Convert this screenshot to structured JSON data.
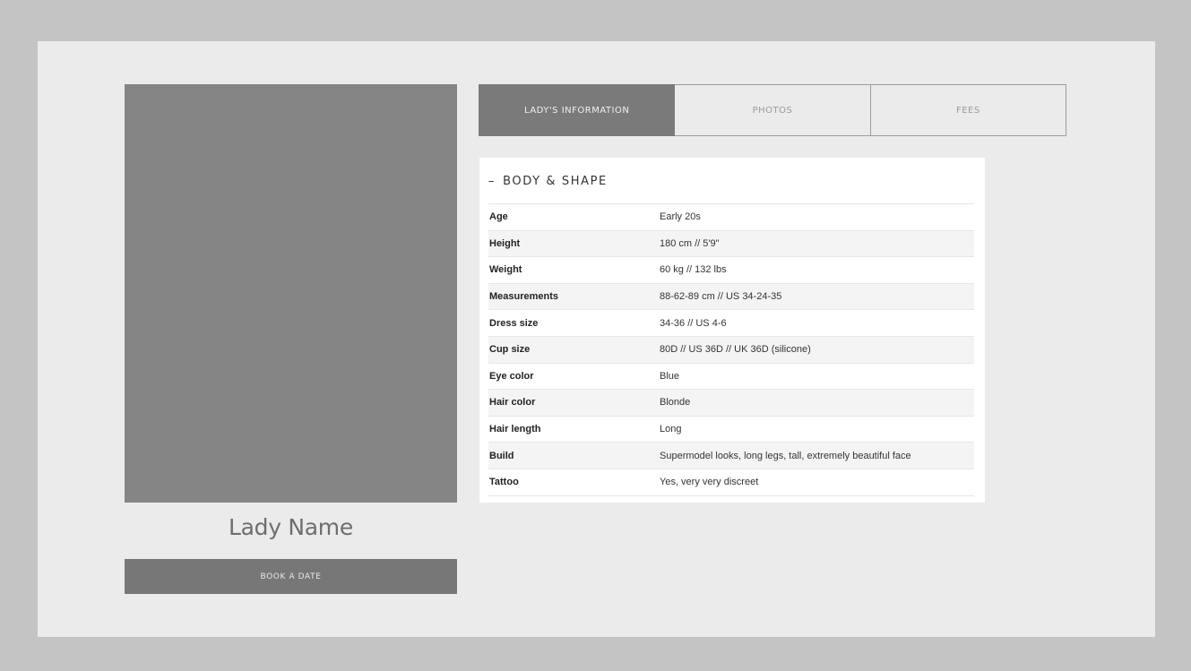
{
  "profile": {
    "name": "Lady Name",
    "book_label": "BOOK A DATE"
  },
  "tabs": [
    {
      "label": "LADY'S INFORMATION",
      "active": true
    },
    {
      "label": "PHOTOS",
      "active": false
    },
    {
      "label": "FEES",
      "active": false
    }
  ],
  "section": {
    "toggle": "–",
    "title": "BODY & SHAPE",
    "rows": [
      {
        "label": "Age",
        "value": "Early 20s"
      },
      {
        "label": "Height",
        "value": "180 cm // 5'9\""
      },
      {
        "label": "Weight",
        "value": "60 kg // 132 lbs"
      },
      {
        "label": "Measurements",
        "value": "88-62-89 cm // US 34-24-35"
      },
      {
        "label": "Dress size",
        "value": "34-36 // US 4-6"
      },
      {
        "label": "Cup size",
        "value": "80D // US 36D // UK 36D (silicone)"
      },
      {
        "label": "Eye color",
        "value": "Blue"
      },
      {
        "label": "Hair color",
        "value": "Blonde"
      },
      {
        "label": "Hair length",
        "value": "Long"
      },
      {
        "label": "Build",
        "value": "Supermodel looks, long legs, tall, extremely beautiful face"
      },
      {
        "label": "Tattoo",
        "value": "Yes, very very discreet"
      }
    ]
  },
  "colors": {
    "outer_bg": "#c4c4c4",
    "page_bg": "#ebebeb",
    "photo_placeholder": "#858585",
    "active_tab": "#7a7a7a",
    "button": "#777777"
  }
}
